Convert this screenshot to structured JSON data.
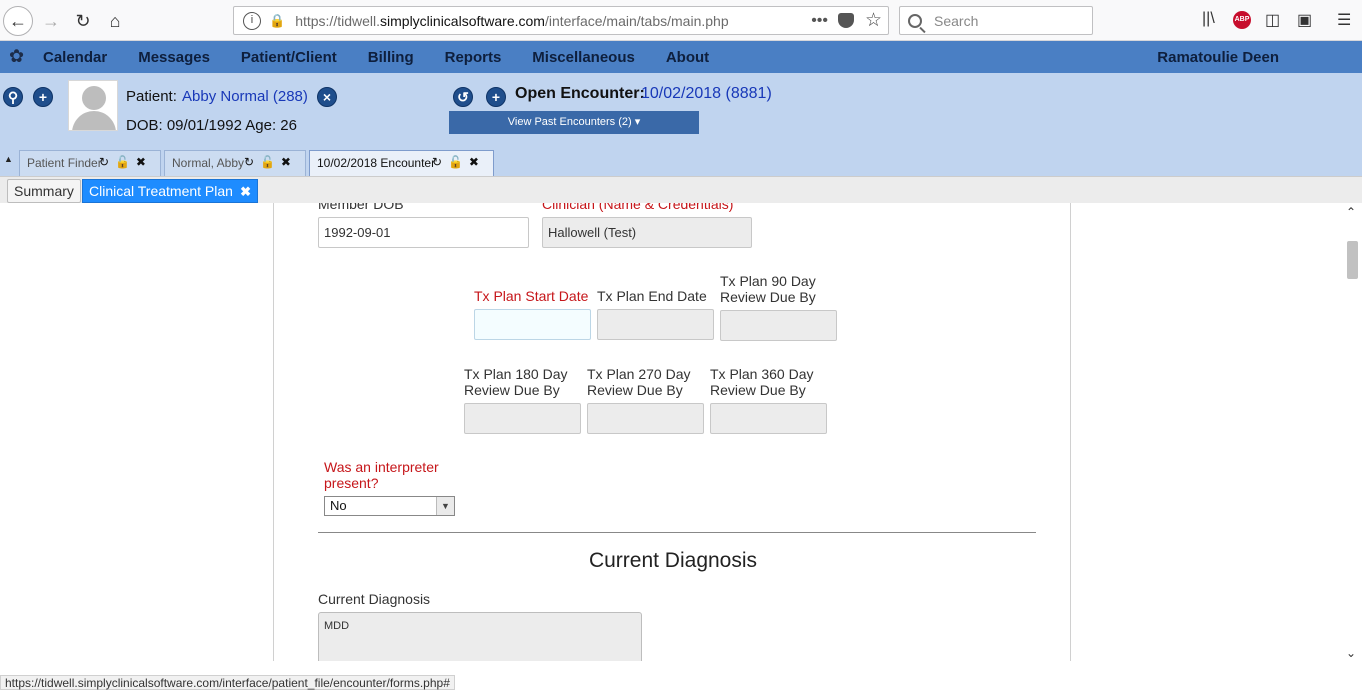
{
  "browser": {
    "url_prefix": "https://tidwell.",
    "url_domain": "simplyclinicalsoftware.com",
    "url_path": "/interface/main/tabs/main.php",
    "search_placeholder": "Search",
    "abp_label": "ABP"
  },
  "menu": {
    "items": [
      "Calendar",
      "Messages",
      "Patient/Client",
      "Billing",
      "Reports",
      "Miscellaneous",
      "About"
    ],
    "user": "Ramatoulie Deen"
  },
  "patient": {
    "label": "Patient:",
    "name": "Abby Normal (288)",
    "dob_line": "DOB: 09/01/1992 Age: 26"
  },
  "encounter": {
    "label": "Open Encounter:",
    "value": "10/02/2018 (8881)",
    "past_button": "View Past Encounters  (2) ▾"
  },
  "tabs": [
    {
      "label": "Patient Finder"
    },
    {
      "label": "Normal, Abby"
    },
    {
      "label": "10/02/2018 Encounter"
    }
  ],
  "subtabs": {
    "summary": "Summary",
    "active": "Clinical Treatment Plan"
  },
  "form": {
    "member_dob_label": "Member DOB",
    "member_dob_value": "1992-09-01",
    "clinician_label": "Clinician (Name & Credentials)",
    "clinician_value": "Hallowell (Test)",
    "tx_start_label": "Tx Plan Start Date",
    "tx_end_label": "Tx Plan End Date",
    "tx_90_label": "Tx Plan 90 Day Review Due By",
    "tx_180_label": "Tx Plan 180 Day Review Due By",
    "tx_270_label": "Tx Plan 270 Day Review Due By",
    "tx_360_label": "Tx Plan 360 Day Review Due By",
    "interpreter_label": "Was an interpreter present?",
    "interpreter_value": "No",
    "section_title": "Current Diagnosis",
    "current_diagnosis_label": "Current Diagnosis",
    "current_diagnosis_value": "MDD"
  },
  "status_url": "https://tidwell.simplyclinicalsoftware.com/interface/patient_file/encounter/forms.php#",
  "colors": {
    "menu_bg": "#4a7fc4",
    "header_bg": "#c0d4ef",
    "active_subtab": "#1e8cff",
    "required_label": "#c6161a",
    "link_blue": "#1838b8"
  }
}
